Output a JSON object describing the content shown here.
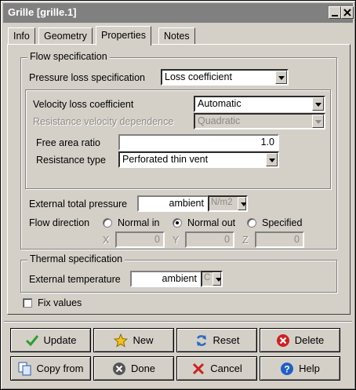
{
  "window": {
    "title": "Grille [grille.1]"
  },
  "tabs": [
    {
      "label": "Info"
    },
    {
      "label": "Geometry"
    },
    {
      "label": "Properties",
      "active": true
    },
    {
      "label": "Notes"
    }
  ],
  "flow": {
    "title": "Flow specification",
    "pressure_loss_label": "Pressure loss specification",
    "pressure_loss_value": "Loss coefficient",
    "velocity_loss_label": "Velocity loss coefficient",
    "velocity_loss_value": "Automatic",
    "resistance_dep_label": "Resistance velocity dependence",
    "resistance_dep_value": "Quadratic",
    "free_area_label": "Free area ratio",
    "free_area_value": "1.0",
    "resistance_type_label": "Resistance type",
    "resistance_type_value": "Perforated thin vent",
    "ext_pressure_label": "External total pressure",
    "ext_pressure_value": "ambient",
    "ext_pressure_unit": "N/m2",
    "direction_label": "Flow direction",
    "direction_options": [
      "Normal in",
      "Normal out",
      "Specified"
    ],
    "direction_selected": "Normal out",
    "x_label": "X",
    "x_value": "0",
    "y_label": "Y",
    "y_value": "0",
    "z_label": "Z",
    "z_value": "0"
  },
  "thermal": {
    "title": "Thermal specification",
    "ext_temp_label": "External temperature",
    "ext_temp_value": "ambient",
    "ext_temp_unit": "C"
  },
  "fix_values_label": "Fix values",
  "buttons": {
    "update": "Update",
    "new": "New",
    "reset": "Reset",
    "delete": "Delete",
    "copy_from": "Copy from",
    "done": "Done",
    "cancel": "Cancel",
    "help": "Help"
  },
  "colors": {
    "face": "#d4d0c8",
    "titlebar": "#808080",
    "update_icon": "#2e9e2e",
    "new_icon": "#f2c21a",
    "reset_icon": "#2a6cc4",
    "delete_icon": "#cc2222",
    "help_icon": "#1f5fc8"
  }
}
